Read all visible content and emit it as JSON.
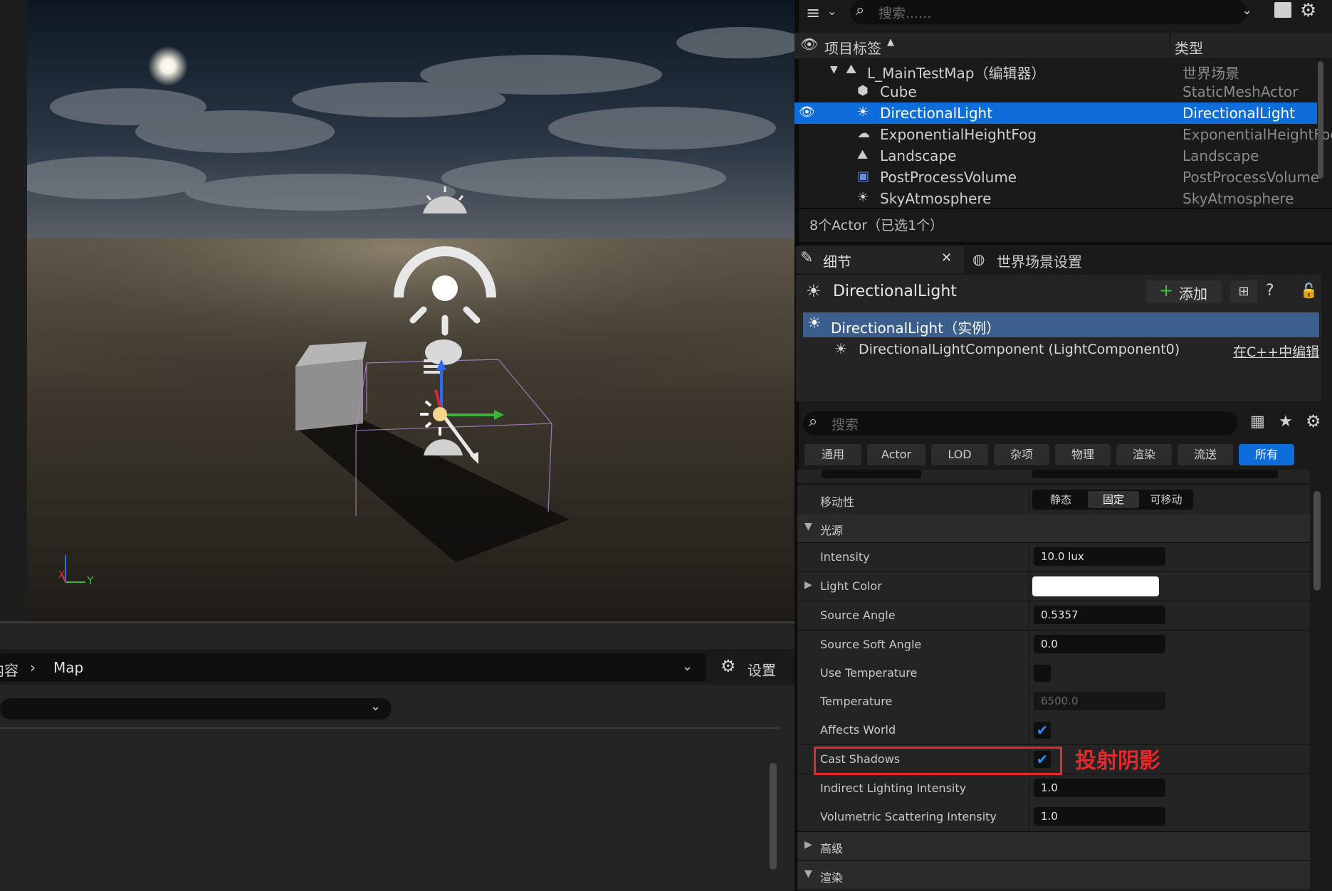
{
  "outliner": {
    "search_placeholder": "搜索......",
    "col_label": "项目标签",
    "col_type": "类型",
    "rows": [
      {
        "name": "L_MainTestMap（编辑器）",
        "type": "世界场景"
      },
      {
        "name": "Cube",
        "type": "StaticMeshActor"
      },
      {
        "name": "DirectionalLight",
        "type": "DirectionalLight"
      },
      {
        "name": "ExponentialHeightFog",
        "type": "ExponentialHeightFog"
      },
      {
        "name": "Landscape",
        "type": "Landscape"
      },
      {
        "name": "PostProcessVolume",
        "type": "PostProcessVolume"
      },
      {
        "name": "SkyAtmosphere",
        "type": "SkyAtmosphere"
      }
    ],
    "status": "8个Actor（已选1个）"
  },
  "details": {
    "tab_details": "细节",
    "tab_world": "世界场景设置",
    "actor_name": "DirectionalLight",
    "add_label": "添加",
    "instance_label": "DirectionalLight（实例）",
    "component_label": "DirectionalLightComponent (LightComponent0)",
    "edit_cpp": "在C++中编辑",
    "search_placeholder": "搜索",
    "filters": [
      "通用",
      "Actor",
      "LOD",
      "杂项",
      "物理",
      "渲染",
      "流送",
      "所有"
    ],
    "mobility_label": "移动性",
    "mobility_options": [
      "静态",
      "固定",
      "可移动"
    ],
    "section_light": "光源",
    "section_advanced": "高级",
    "section_render": "渲染",
    "props": {
      "intensity": {
        "label": "Intensity",
        "value": "10.0 lux"
      },
      "light_color": {
        "label": "Light Color"
      },
      "source_angle": {
        "label": "Source Angle",
        "value": "0.5357"
      },
      "source_soft_angle": {
        "label": "Source Soft Angle",
        "value": "0.0"
      },
      "use_temperature": {
        "label": "Use Temperature"
      },
      "temperature": {
        "label": "Temperature",
        "value": "6500.0"
      },
      "affects_world": {
        "label": "Affects World"
      },
      "cast_shadows": {
        "label": "Cast Shadows"
      },
      "indirect": {
        "label": "Indirect Lighting Intensity",
        "value": "1.0"
      },
      "volumetric": {
        "label": "Volumetric Scattering Intensity",
        "value": "1.0"
      }
    },
    "annotation": "投射阴影"
  },
  "content_browser": {
    "path_prev": "内容",
    "path_current": "Map",
    "settings_label": "设置"
  },
  "viewport": {
    "axis_y": "Y",
    "axis_x": "X"
  },
  "colors": {
    "accent": "#0e6dd8",
    "annotation": "#e8262b",
    "check": "#2b8cff"
  }
}
